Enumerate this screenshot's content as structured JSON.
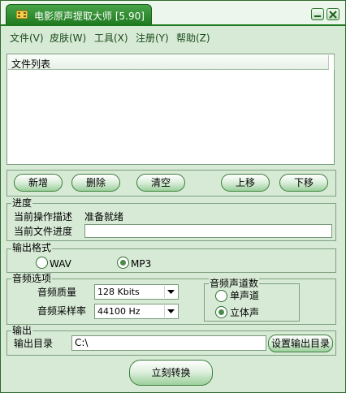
{
  "window": {
    "title": "电影原声提取大师 [5.90]"
  },
  "menu": [
    "文件(V)",
    "皮肤(W)",
    "工具(X)",
    "注册(Y)",
    "帮助(Z)"
  ],
  "file_list": {
    "header": "文件列表"
  },
  "toolbar": {
    "add": "新增",
    "delete": "删除",
    "clear": "清空",
    "up": "上移",
    "down": "下移"
  },
  "progress": {
    "legend": "进度",
    "operation_label": "当前操作描述",
    "operation_value": "准备就绪",
    "file_progress_label": "当前文件进度",
    "file_progress": 0
  },
  "format": {
    "legend": "输出格式",
    "wav": "WAV",
    "mp3": "MP3",
    "selected": "MP3"
  },
  "audio": {
    "legend": "音频选项",
    "quality_label": "音频质量",
    "quality_value": "128 Kbits",
    "samplerate_label": "音频采样率",
    "samplerate_value": "44100 Hz",
    "channels": {
      "legend": "音频声道数",
      "mono": "单声道",
      "stereo": "立体声",
      "selected": "立体声"
    }
  },
  "output": {
    "legend": "输出",
    "dir_label": "输出目录",
    "dir_value": "C:\\",
    "set_dir_button": "设置输出目录"
  },
  "convert_button": "立刻转换",
  "colors": {
    "accent": "#1f7a1f",
    "panel": "#d7ead6"
  }
}
